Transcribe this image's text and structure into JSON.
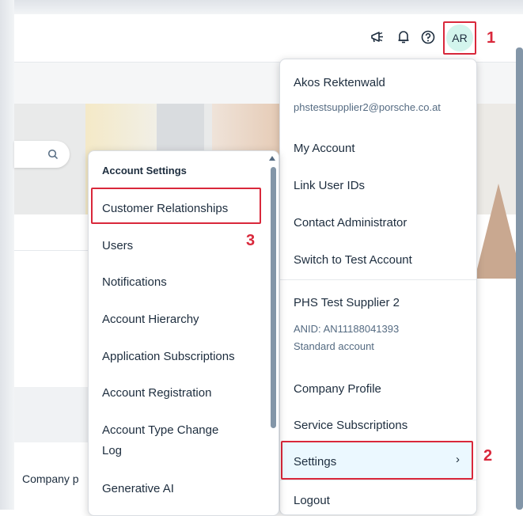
{
  "header": {
    "avatar_initials": "AR",
    "icons": [
      "megaphone-icon",
      "bell-icon",
      "help-icon"
    ]
  },
  "background": {
    "company_label_partial": "Company p"
  },
  "user_menu": {
    "user_name": "Akos Rektenwald",
    "user_email": "phstestsupplier2@porsche.co.at",
    "items": [
      "My Account",
      "Link User IDs",
      "Contact Administrator",
      "Switch to Test Account"
    ],
    "company_name": "PHS Test Supplier 2",
    "anid": "ANID: AN11188041393",
    "account_type": "Standard account",
    "company_profile": "Company Profile",
    "service_subscriptions": "Service Subscriptions",
    "settings": "Settings",
    "settings_chevron": "›",
    "logout": "Logout"
  },
  "account_settings_menu": {
    "title": "Account Settings",
    "items": [
      "Customer Relationships",
      "Users",
      "Notifications",
      "Account Hierarchy",
      "Application Subscriptions",
      "Account Registration",
      "Account Type Change",
      "Log",
      "Generative AI"
    ]
  },
  "annotations": {
    "step1": "1",
    "step2": "2",
    "step3": "3",
    "highlight_color": "#d9283b"
  }
}
